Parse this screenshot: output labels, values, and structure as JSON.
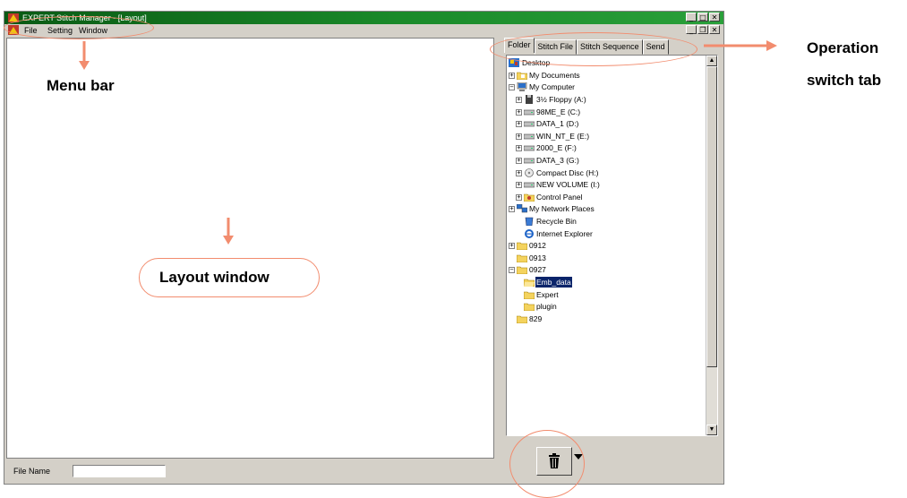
{
  "window": {
    "title": "EXPERT Stitch Manager - [Layout]",
    "buttons": {
      "minimize": "_",
      "maximize": "□",
      "close": "✕"
    },
    "mdi_buttons": {
      "minimize": "_",
      "restore": "❐",
      "close": "✕"
    }
  },
  "menu": {
    "items": [
      "File",
      "Setting",
      "Window"
    ]
  },
  "tabs": [
    "Folder",
    "Stitch File",
    "Stitch Sequence",
    "Send"
  ],
  "tree": {
    "nodes": [
      {
        "label": "Desktop",
        "icon": "desktop-icon"
      },
      {
        "label": "My Documents",
        "icon": "folder-documents-icon"
      },
      {
        "label": "My Computer",
        "icon": "computer-icon"
      },
      {
        "label": "3½ Floppy (A:)",
        "icon": "floppy-icon"
      },
      {
        "label": "98ME_E (C:)",
        "icon": "drive-icon"
      },
      {
        "label": "DATA_1 (D:)",
        "icon": "drive-icon"
      },
      {
        "label": "WIN_NT_E (E:)",
        "icon": "drive-icon"
      },
      {
        "label": "2000_E (F:)",
        "icon": "drive-icon"
      },
      {
        "label": "DATA_3 (G:)",
        "icon": "drive-icon"
      },
      {
        "label": "Compact Disc (H:)",
        "icon": "cd-icon"
      },
      {
        "label": "NEW VOLUME (I:)",
        "icon": "drive-icon"
      },
      {
        "label": "Control Panel",
        "icon": "control-panel-icon"
      },
      {
        "label": "My Network Places",
        "icon": "network-icon"
      },
      {
        "label": "Recycle Bin",
        "icon": "recycle-bin-icon"
      },
      {
        "label": "Internet Explorer",
        "icon": "ie-icon"
      },
      {
        "label": "0912",
        "icon": "folder-icon"
      },
      {
        "label": "0913",
        "icon": "folder-icon"
      },
      {
        "label": "0927",
        "icon": "folder-icon"
      },
      {
        "label": "Emb_data",
        "icon": "folder-open-icon",
        "selected": true
      },
      {
        "label": "Expert",
        "icon": "folder-icon"
      },
      {
        "label": "plugin",
        "icon": "folder-icon"
      },
      {
        "label": "829",
        "icon": "folder-icon"
      }
    ],
    "scroll_up": "▲",
    "scroll_down": "▼"
  },
  "file_name": {
    "label": "File Name",
    "value": ""
  },
  "annotations": {
    "menu_bar": "Menu bar",
    "layout_window": "Layout window",
    "operation_line1": "Operation",
    "operation_line2": "switch tab"
  },
  "colors": {
    "annotation": "#f28c6e",
    "title_bar": "#0a5a14",
    "selection": "#0a246a"
  }
}
